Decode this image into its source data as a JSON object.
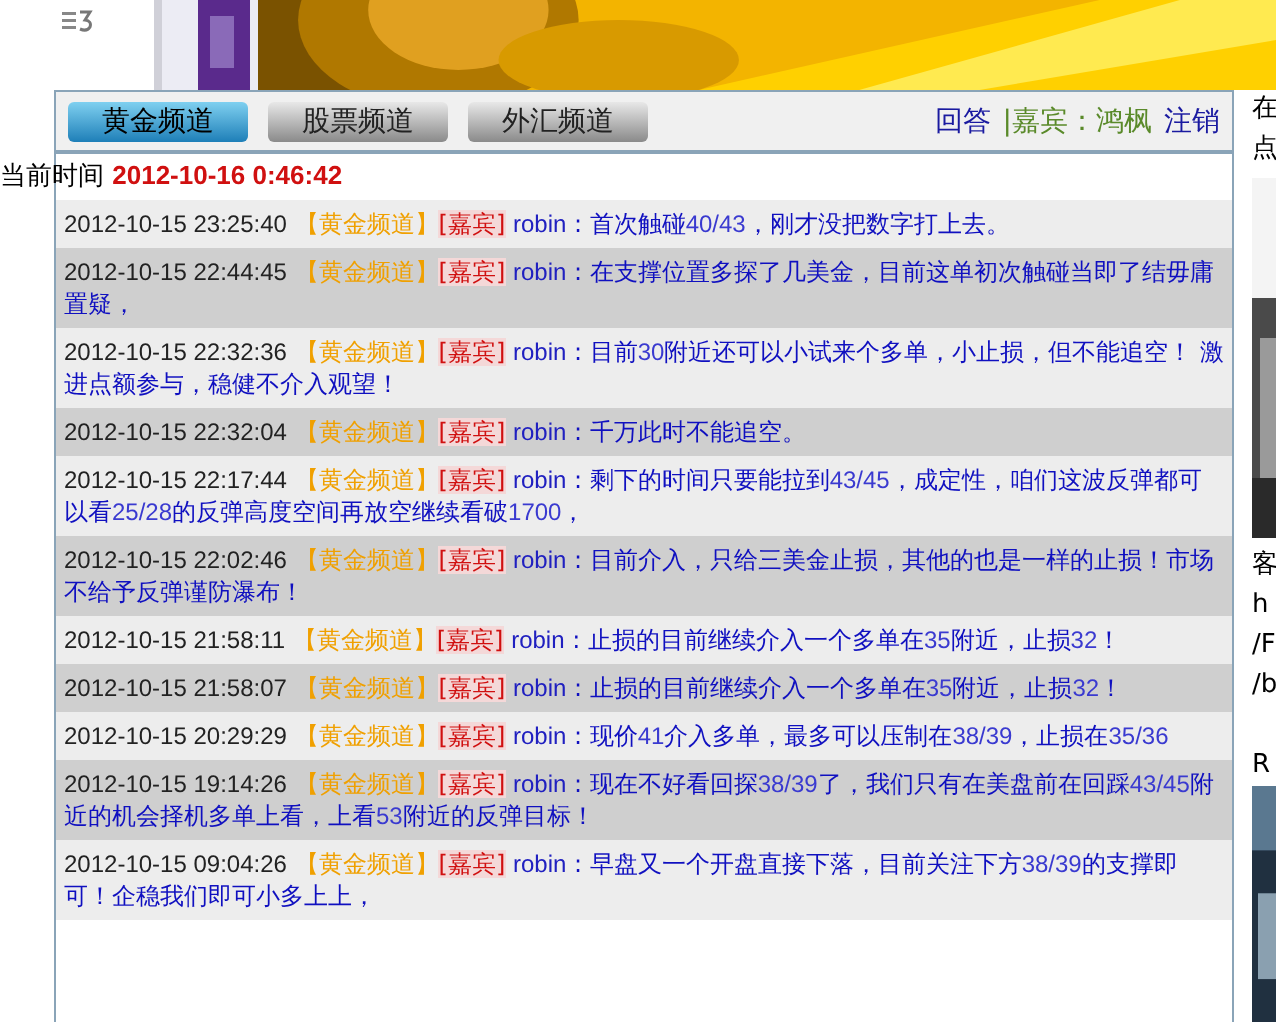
{
  "tabs": [
    {
      "label": "黄金频道",
      "selected": true
    },
    {
      "label": "股票频道",
      "selected": false
    },
    {
      "label": "外汇频道",
      "selected": false
    }
  ],
  "header_links": {
    "answer": "回答",
    "guest": "|嘉宾：鸿枫",
    "logout": "注销"
  },
  "clock": {
    "label": "当前时间",
    "time": "2012-10-16 0:46:42"
  },
  "name_separator": ":",
  "messages": [
    {
      "time": "2012-10-15 23:25:40",
      "channel": "【黄金频道】",
      "role": "[嘉宾]",
      "user": "robin",
      "parts": [
        {
          "text": "首次触碰",
          "kind": "text"
        },
        {
          "text": "40/43",
          "kind": "number"
        },
        {
          "text": "，刚才没把数字打上去。",
          "kind": "text"
        }
      ]
    },
    {
      "time": "2012-10-15 22:44:45",
      "channel": "【黄金频道】",
      "role": "[嘉宾]",
      "user": "robin",
      "parts": [
        {
          "text": "在支撑位置多探了几美金，目前这单初次触碰当即了结毋庸置疑，",
          "kind": "text"
        }
      ]
    },
    {
      "time": "2012-10-15 22:32:36",
      "channel": "【黄金频道】",
      "role": "[嘉宾]",
      "user": "robin",
      "parts": [
        {
          "text": "目前",
          "kind": "text"
        },
        {
          "text": "30",
          "kind": "number"
        },
        {
          "text": "附近还可以小试来个多单，小止损，但不能追空！ 激进点额参与，稳健不介入观望！",
          "kind": "text"
        }
      ]
    },
    {
      "time": "2012-10-15 22:32:04",
      "channel": "【黄金频道】",
      "role": "[嘉宾]",
      "user": "robin",
      "parts": [
        {
          "text": "千万此时不能追空。",
          "kind": "text"
        }
      ]
    },
    {
      "time": "2012-10-15 22:17:44",
      "channel": "【黄金频道】",
      "role": "[嘉宾]",
      "user": "robin",
      "parts": [
        {
          "text": "剩下的时间只要能拉到",
          "kind": "text"
        },
        {
          "text": "43/45",
          "kind": "number"
        },
        {
          "text": "，成定性，咱们这波反弹都可以看",
          "kind": "text"
        },
        {
          "text": "25/28",
          "kind": "number"
        },
        {
          "text": "的反弹高度空间再放空继续看破",
          "kind": "text"
        },
        {
          "text": "1700",
          "kind": "number"
        },
        {
          "text": "，",
          "kind": "text"
        }
      ]
    },
    {
      "time": "2012-10-15 22:02:46",
      "channel": "【黄金频道】",
      "role": "[嘉宾]",
      "user": "robin",
      "parts": [
        {
          "text": "目前介入，只给三美金止损，其他的也是一样的止损！市场不给予反弹谨防瀑布！",
          "kind": "text"
        }
      ]
    },
    {
      "time": "2012-10-15 21:58:11",
      "channel": "【黄金频道】",
      "role": "[嘉宾]",
      "user": "robin",
      "parts": [
        {
          "text": "止损的目前继续介入一个多单在",
          "kind": "text"
        },
        {
          "text": "35",
          "kind": "number"
        },
        {
          "text": "附近，止损",
          "kind": "text"
        },
        {
          "text": "32",
          "kind": "number"
        },
        {
          "text": "！",
          "kind": "text"
        }
      ]
    },
    {
      "time": "2012-10-15 21:58:07",
      "channel": "【黄金频道】",
      "role": "[嘉宾]",
      "user": "robin",
      "parts": [
        {
          "text": "止损的目前继续介入一个多单在",
          "kind": "text"
        },
        {
          "text": "35",
          "kind": "number"
        },
        {
          "text": "附近，止损",
          "kind": "text"
        },
        {
          "text": "32",
          "kind": "number"
        },
        {
          "text": "！",
          "kind": "text"
        }
      ]
    },
    {
      "time": "2012-10-15 20:29:29",
      "channel": "【黄金频道】",
      "role": "[嘉宾]",
      "user": "robin",
      "parts": [
        {
          "text": "现价",
          "kind": "text"
        },
        {
          "text": "41",
          "kind": "number"
        },
        {
          "text": "介入多单，最多可以压制在",
          "kind": "text"
        },
        {
          "text": "38/39",
          "kind": "number"
        },
        {
          "text": "，止损在",
          "kind": "text"
        },
        {
          "text": "35/36",
          "kind": "number"
        }
      ]
    },
    {
      "time": "2012-10-15 19:14:26",
      "channel": "【黄金频道】",
      "role": "[嘉宾]",
      "user": "robin",
      "parts": [
        {
          "text": "现在不好看回探",
          "kind": "text"
        },
        {
          "text": "38/39",
          "kind": "number"
        },
        {
          "text": "了，我们只有在美盘前在回踩",
          "kind": "text"
        },
        {
          "text": "43/45",
          "kind": "number"
        },
        {
          "text": "附近的机会择机多单上看，上看",
          "kind": "text"
        },
        {
          "text": "53",
          "kind": "number"
        },
        {
          "text": "附近的反弹目标！",
          "kind": "text"
        }
      ]
    },
    {
      "time": "2012-10-15 09:04:26",
      "channel": "【黄金频道】",
      "role": "[嘉宾]",
      "user": "robin",
      "parts": [
        {
          "text": "早盘又一个开盘直接下落，目前关注下方",
          "kind": "text"
        },
        {
          "text": "38/39",
          "kind": "number"
        },
        {
          "text": "的支撑即可！企稳我们即可小多上上，",
          "kind": "text"
        }
      ]
    }
  ],
  "sidebar_fragments": {
    "top": [
      "在",
      "点"
    ],
    "middle": [
      "客",
      "h",
      "/F",
      "/b"
    ],
    "bottom": [
      "R"
    ]
  }
}
